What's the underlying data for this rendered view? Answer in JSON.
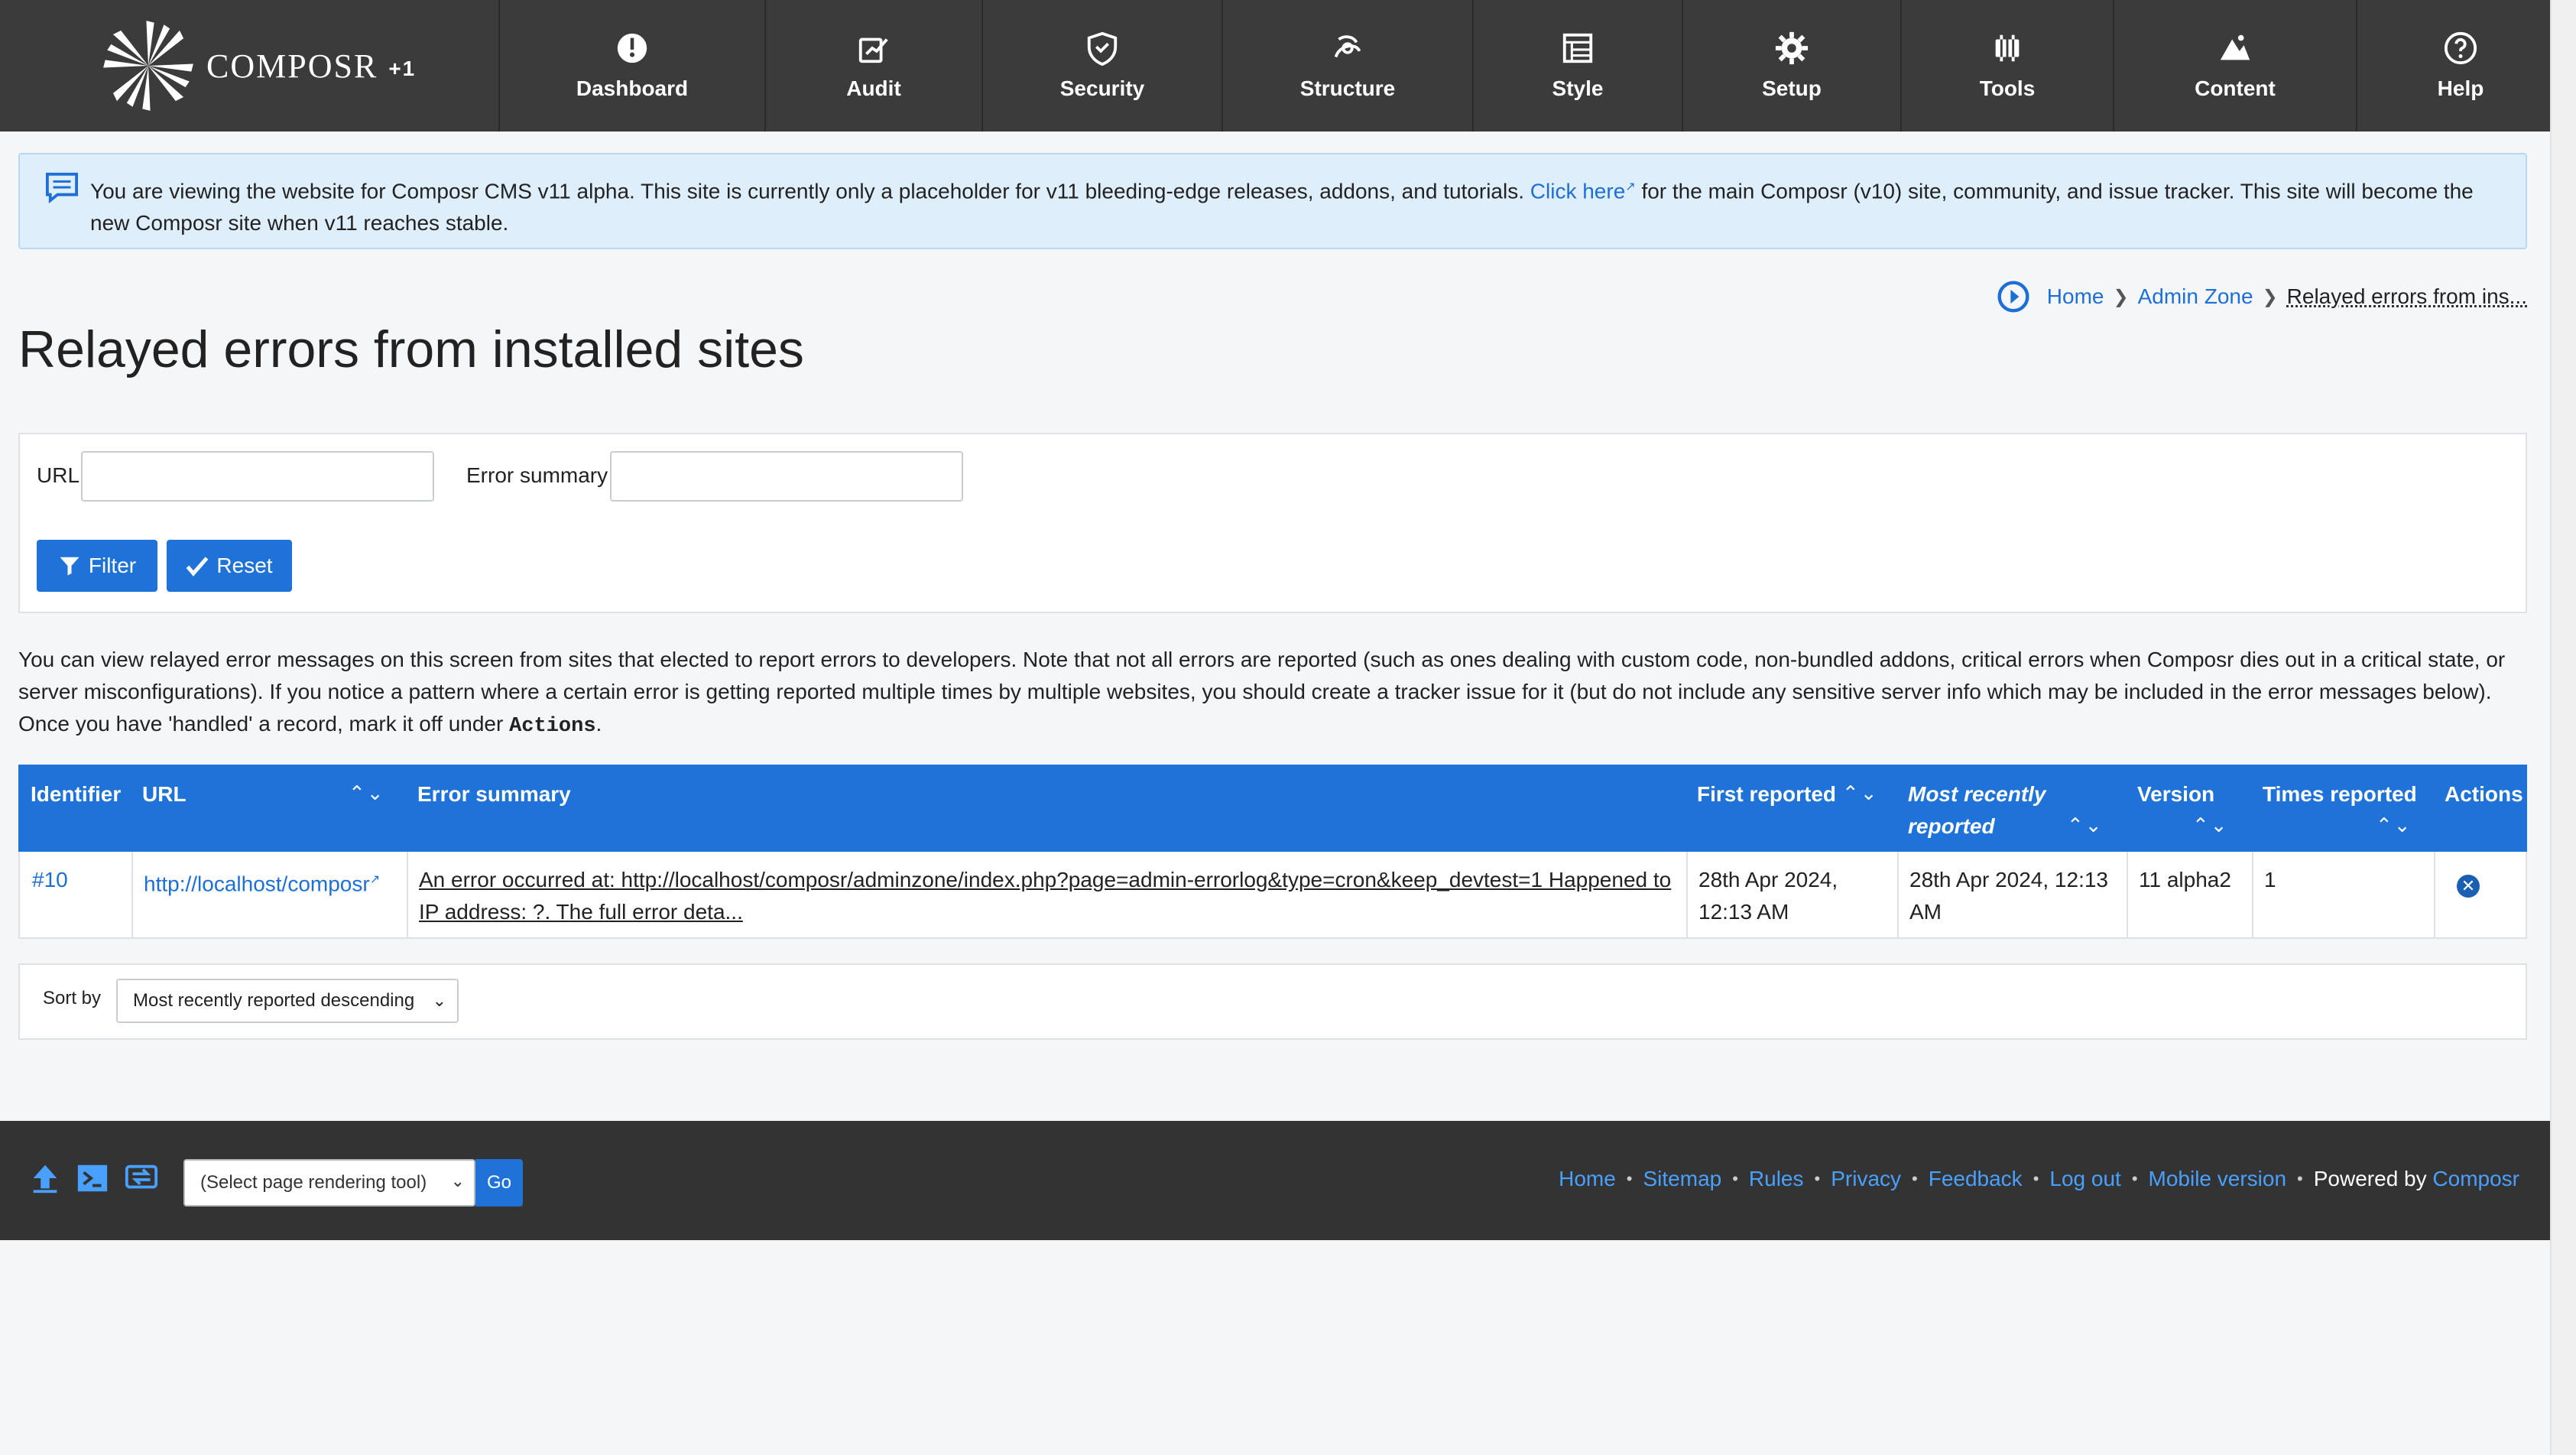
{
  "brand": {
    "name": "COMPOSR",
    "plus": "+1"
  },
  "nav": [
    {
      "label": "Dashboard",
      "icon": "dashboard-icon"
    },
    {
      "label": "Audit",
      "icon": "audit-icon"
    },
    {
      "label": "Security",
      "icon": "security-icon"
    },
    {
      "label": "Structure",
      "icon": "structure-icon"
    },
    {
      "label": "Style",
      "icon": "style-icon"
    },
    {
      "label": "Setup",
      "icon": "setup-icon"
    },
    {
      "label": "Tools",
      "icon": "tools-icon"
    },
    {
      "label": "Content",
      "icon": "content-icon"
    },
    {
      "label": "Help",
      "icon": "help-icon"
    }
  ],
  "banner": {
    "text_before": "You are viewing the website for Composr CMS v11 alpha. This site is currently only a placeholder for v11 bleeding-edge releases, addons, and tutorials. ",
    "link": "Click here",
    "text_after": " for the main Composr (v10) site, community, and issue tracker. This site will become the new Composr site when v11 reaches stable."
  },
  "breadcrumb": {
    "home": "Home",
    "admin": "Admin Zone",
    "current": "Relayed errors from ins..."
  },
  "page_title": "Relayed errors from installed sites",
  "filter": {
    "url_label": "URL",
    "url_value": "",
    "summary_label": "Error summary",
    "summary_value": "",
    "filter_button": "Filter",
    "reset_button": "Reset"
  },
  "description": {
    "text": "You can view relayed error messages on this screen from sites that elected to report errors to developers. Note that not all errors are reported (such as ones dealing with custom code, non-bundled addons, critical errors when Composr dies out in a critical state, or server misconfigurations). If you notice a pattern where a certain error is getting reported multiple times by multiple websites, you should create a tracker issue for it (but do not include any sensitive server info which may be included in the error messages below). Once you have 'handled' a record, mark it off under ",
    "code": "Actions",
    "end": "."
  },
  "table": {
    "headers": {
      "identifier": "Identifier",
      "url": "URL",
      "summary": "Error summary",
      "first": "First reported",
      "recent": "Most recently reported",
      "version": "Version",
      "times": "Times reported",
      "actions": "Actions"
    },
    "row": {
      "identifier": "#10",
      "url": "http://localhost/composr",
      "summary": "An error occurred at: http://localhost/composr/adminzone/index.php?page=admin-errorlog&type=cron&keep_devtest=1 Happened to IP address: ?. The full error deta...",
      "first": "28th Apr 2024, 12:13 AM",
      "recent": "28th Apr 2024, 12:13 AM",
      "version": "11 alpha2",
      "times": "1"
    }
  },
  "sort": {
    "label": "Sort by",
    "value": "Most recently reported descending"
  },
  "footer": {
    "tool_select": "(Select page rendering tool)",
    "go": "Go",
    "links": [
      "Home",
      "Sitemap",
      "Rules",
      "Privacy",
      "Feedback",
      "Log out",
      "Mobile version"
    ],
    "powered_by": "Powered by",
    "powered_link": "Composr"
  },
  "colors": {
    "nav_bg": "#3b3b3b",
    "accent": "#1f73d8",
    "link": "#1d6fd6",
    "banner_bg": "#dfeefb",
    "footer_bg": "#333333"
  }
}
